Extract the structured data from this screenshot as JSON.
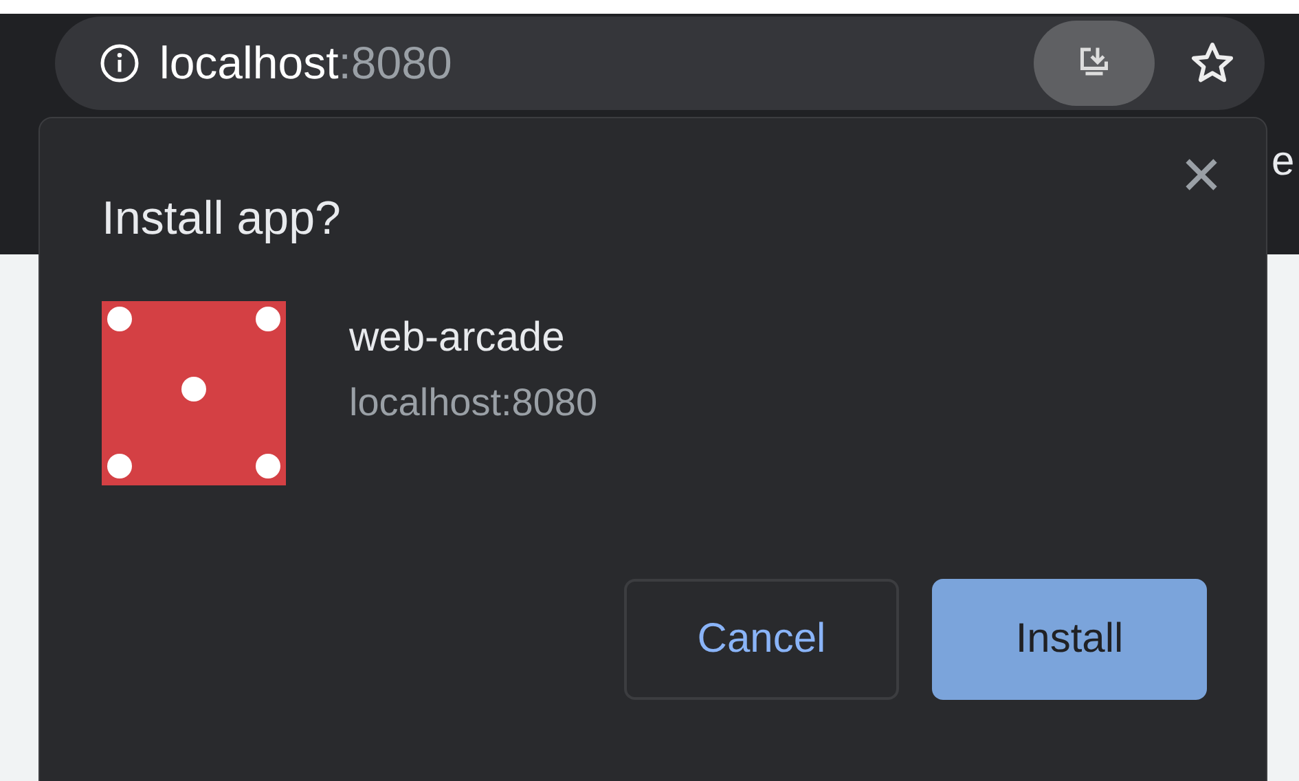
{
  "omnibox": {
    "host": "localhost",
    "port": ":8080"
  },
  "bookmarks_bar": {
    "text": "e"
  },
  "dialog": {
    "title": "Install app?",
    "app_name": "web-arcade",
    "app_origin": "localhost:8080",
    "buttons": [
      {
        "label": "Cancel",
        "kind": "secondary"
      },
      {
        "label": "Install",
        "kind": "primary"
      }
    ]
  }
}
